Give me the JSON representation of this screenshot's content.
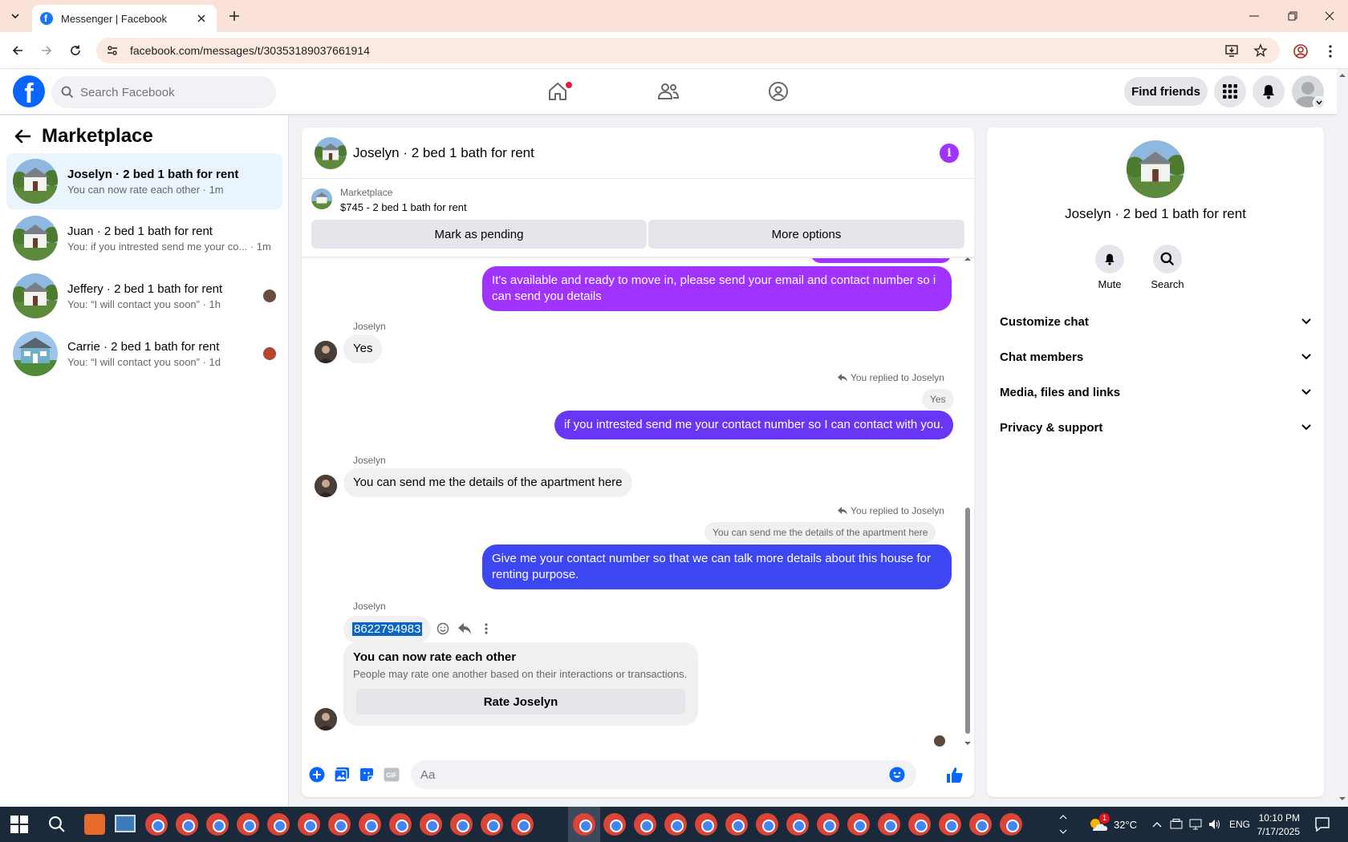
{
  "browser": {
    "tab_title": "Messenger | Facebook",
    "url": "facebook.com/messages/t/30353189037661914"
  },
  "fb": {
    "logo": "f",
    "search_placeholder": "Search Facebook",
    "find_friends": "Find friends"
  },
  "sidebar": {
    "title": "Marketplace",
    "conversations": [
      {
        "name": "Joselyn · 2 bed 1 bath for rent",
        "preview": "You can now rate each other · 1m",
        "active": true
      },
      {
        "name": "Juan · 2 bed 1 bath for rent",
        "preview": "You: if you intrested send me your co... · 1m",
        "active": false
      },
      {
        "name": "Jeffery · 2 bed 1 bath for rent",
        "preview": "You: “I will contact you soon” · 1h",
        "active": false
      },
      {
        "name": "Carrie · 2 bed 1 bath for rent",
        "preview": "You: “I will contact you soon” · 1d",
        "active": false
      }
    ]
  },
  "chat": {
    "title": "Joselyn · 2 bed 1 bath for rent",
    "listing_source": "Marketplace",
    "listing_price": "$745 - 2 bed 1 bath for rent",
    "mark_pending": "Mark as pending",
    "more_options": "More options",
    "messages": {
      "m1": "It's available and ready to move in, please send your email and contact number so i can send you details",
      "sender1": "Joselyn",
      "m2": "Yes",
      "replied1": "You replied to Joselyn",
      "quote1": "Yes",
      "m3": "if you intrested send me your contact number so I can contact with you.",
      "sender2": "Joselyn",
      "m4": "You can send me the details of the apartment here",
      "replied2": "You replied to Joselyn",
      "quote2": "You can send me the details of the apartment here",
      "m5": "Give me your contact number so that we can talk more details about this house for renting purpose.",
      "sender3": "Joselyn",
      "m6": "8622794983"
    },
    "rate_title": "You can now rate each other",
    "rate_sub": "People may rate one another based on their interactions or transactions.",
    "rate_button": "Rate Joselyn",
    "composer_placeholder": "Aa"
  },
  "info": {
    "name": "Joselyn · 2 bed 1 bath for rent",
    "mute": "Mute",
    "search": "Search",
    "sections": [
      "Customize chat",
      "Chat members",
      "Media, files and links",
      "Privacy & support"
    ]
  },
  "taskbar": {
    "temp": "32°C",
    "lang": "ENG",
    "time": "10:10 PM",
    "date": "7/17/2025",
    "weather_badge": "1"
  },
  "colors": {
    "fb_blue": "#0866ff",
    "bubble_purple": "#a033ff",
    "bubble_blue": "#3c47f2",
    "active_conv": "#ebf5ff"
  }
}
